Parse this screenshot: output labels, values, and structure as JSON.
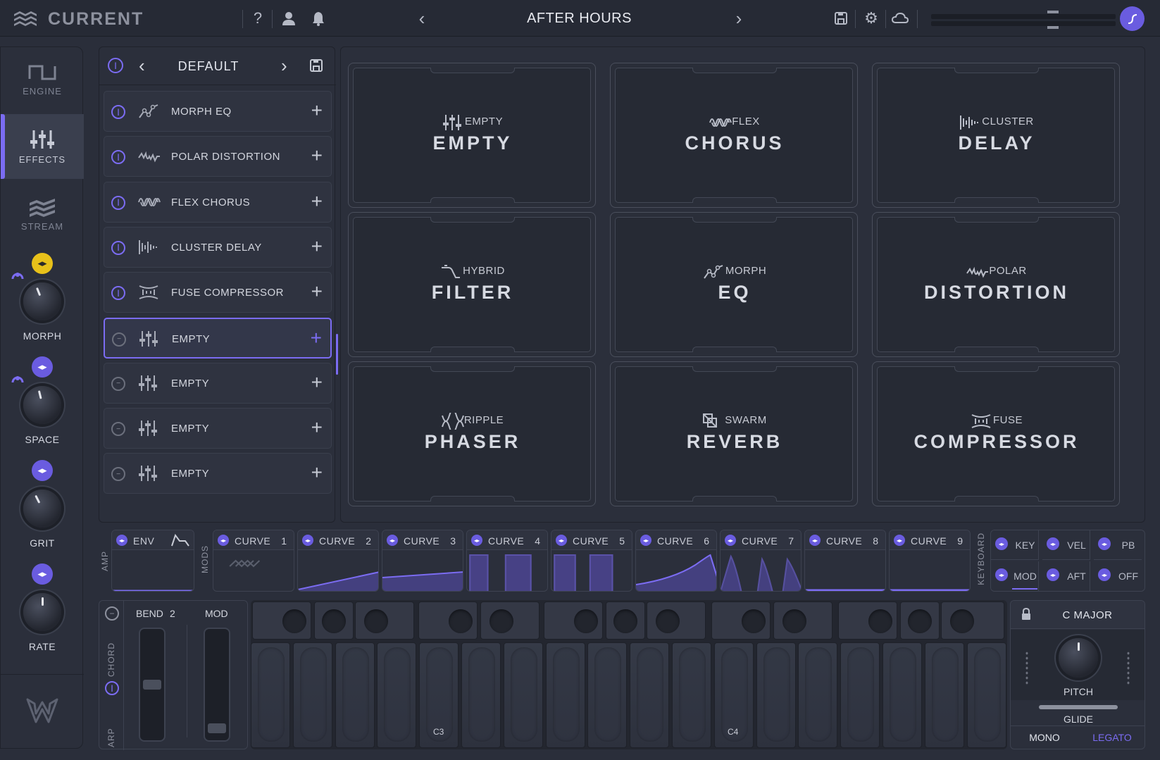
{
  "topbar": {
    "brand": "CURRENT",
    "preset_name": "AFTER HOURS",
    "icons": [
      "help-icon",
      "user-icon",
      "bell-icon",
      "save-icon",
      "gear-icon",
      "cloud-icon"
    ]
  },
  "nav": {
    "tabs": [
      {
        "label": "ENGINE",
        "icon": "engine-icon",
        "active": false
      },
      {
        "label": "EFFECTS",
        "icon": "sliders-icon",
        "active": true
      },
      {
        "label": "STREAM",
        "icon": "stream-icon",
        "active": false
      }
    ],
    "macros": [
      {
        "label": "MORPH",
        "value": 0.42
      },
      {
        "label": "SPACE",
        "value": 0.45
      },
      {
        "label": "GRIT",
        "value": 0.4
      },
      {
        "label": "RATE",
        "value": 0.5
      }
    ]
  },
  "fx_chain": {
    "preset": "DEFAULT",
    "slots": [
      {
        "label": "MORPH EQ",
        "icon": "morph-eq-icon",
        "enabled": true,
        "selected": false
      },
      {
        "label": "POLAR DISTORTION",
        "icon": "polar-distortion-icon",
        "enabled": true,
        "selected": false
      },
      {
        "label": "FLEX CHORUS",
        "icon": "flex-chorus-icon",
        "enabled": true,
        "selected": false
      },
      {
        "label": "CLUSTER DELAY",
        "icon": "cluster-delay-icon",
        "enabled": true,
        "selected": false
      },
      {
        "label": "FUSE COMPRESSOR",
        "icon": "fuse-compressor-icon",
        "enabled": true,
        "selected": false
      },
      {
        "label": "EMPTY",
        "icon": "empty-slot-icon",
        "enabled": false,
        "selected": true
      },
      {
        "label": "EMPTY",
        "icon": "empty-slot-icon",
        "enabled": false,
        "selected": false
      },
      {
        "label": "EMPTY",
        "icon": "empty-slot-icon",
        "enabled": false,
        "selected": false
      },
      {
        "label": "EMPTY",
        "icon": "empty-slot-icon",
        "enabled": false,
        "selected": false
      }
    ]
  },
  "fx_grid": [
    {
      "sub": "EMPTY",
      "main": "EMPTY",
      "icon": "sliders-icon"
    },
    {
      "sub": "FLEX",
      "main": "CHORUS",
      "icon": "flex-chorus-icon"
    },
    {
      "sub": "CLUSTER",
      "main": "DELAY",
      "icon": "cluster-delay-icon"
    },
    {
      "sub": "HYBRID",
      "main": "FILTER",
      "icon": "hybrid-filter-icon"
    },
    {
      "sub": "MORPH",
      "main": "EQ",
      "icon": "morph-eq-icon"
    },
    {
      "sub": "POLAR",
      "main": "DISTORTION",
      "icon": "polar-distortion-icon"
    },
    {
      "sub": "RIPPLE",
      "main": "PHASER",
      "icon": "ripple-phaser-icon"
    },
    {
      "sub": "SWARM",
      "main": "REVERB",
      "icon": "swarm-reverb-icon"
    },
    {
      "sub": "FUSE",
      "main": "COMPRESSOR",
      "icon": "fuse-compressor-icon"
    }
  ],
  "mods": {
    "amp_label": "AMP",
    "mods_label": "MODS",
    "env_label": "ENV",
    "curve_label": "CURVE",
    "curves": [
      "1",
      "2",
      "3",
      "4",
      "5",
      "6",
      "7",
      "8",
      "9"
    ],
    "keyboard_label": "KEYBOARD",
    "keyboard_sources": [
      "KEY",
      "VEL",
      "PB",
      "MOD",
      "AFT",
      "OFF"
    ]
  },
  "performance": {
    "chord_label": "CHORD",
    "arp_label": "ARP",
    "bend_label": "BEND",
    "bend_range": "2",
    "mod_label": "MOD",
    "key_labels": [
      "C3",
      "C4"
    ],
    "scale": "C  MAJOR",
    "pitch_label": "PITCH",
    "glide_label": "GLIDE",
    "mono_label": "MONO",
    "legato_label": "LEGATO"
  },
  "colors": {
    "accent": "#7b6cf2",
    "macro_yellow": "#e8c11a",
    "background": "#2a2e3a"
  }
}
